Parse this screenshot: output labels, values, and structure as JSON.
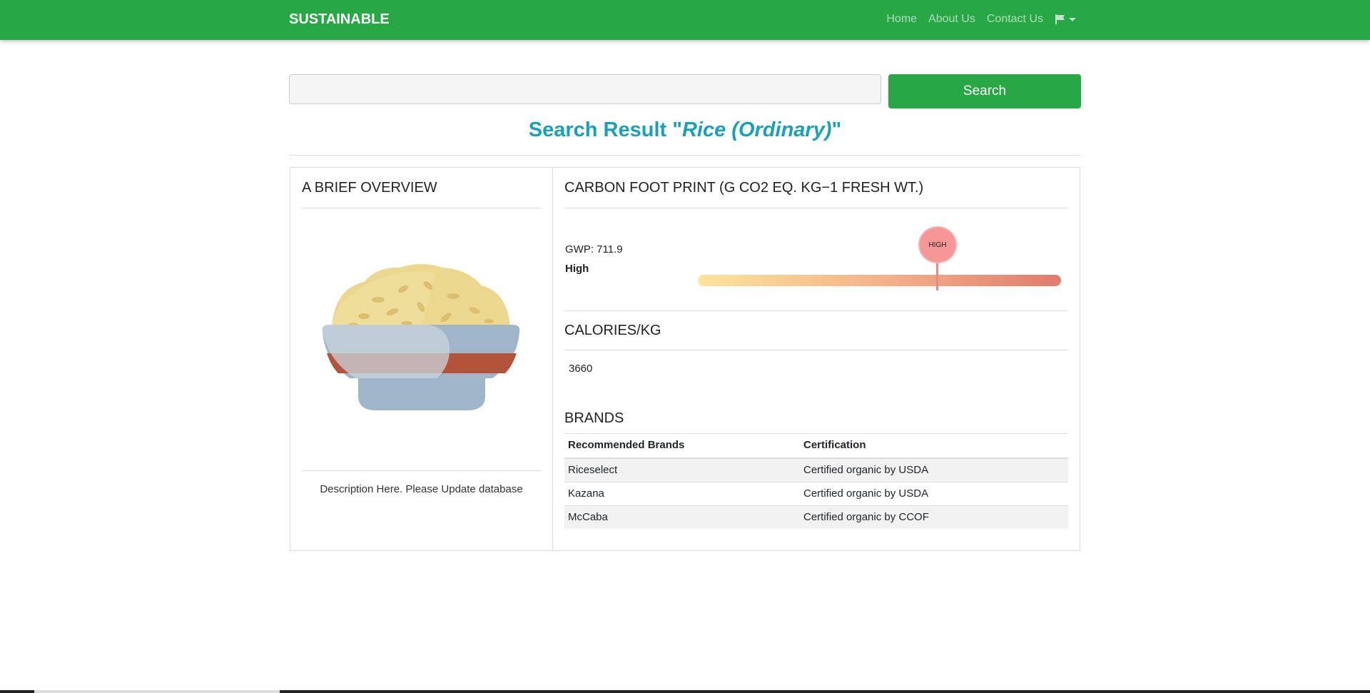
{
  "navbar": {
    "brand": "SUSTAINABLE",
    "links": [
      "Home",
      "About Us",
      "Contact Us"
    ],
    "language_icon": "flag-icon"
  },
  "search": {
    "value": "",
    "button_label": "Search"
  },
  "result": {
    "prefix": "Search Result \"",
    "query": "Rice (Ordinary)",
    "suffix": "\""
  },
  "overview": {
    "heading": "A BRIEF OVERVIEW",
    "image_icon": "rice-bowl-icon",
    "description": "Description Here. Please Update database"
  },
  "carbon": {
    "heading": "CARBON FOOT PRINT (G CO2 EQ. KG−1 FRESH WT.)",
    "gwp_text": "GWP: 711.9",
    "level_text": "High",
    "gauge_label": "HIGH",
    "gauge_level_fraction": 0.66
  },
  "calories": {
    "heading": "CALORIES/KG",
    "value": "3660"
  },
  "brands": {
    "heading": "BRANDS",
    "columns": [
      "Recommended Brands",
      "Certification"
    ],
    "rows": [
      [
        "Riceselect",
        "Certified organic by USDA"
      ],
      [
        "Kazana",
        "Certified organic by USDA"
      ],
      [
        "McCaba",
        "Certified organic by CCOF"
      ]
    ]
  },
  "colors": {
    "primary": "#28a745",
    "title": "#17a2b8",
    "gauge_start": "#fde49c",
    "gauge_end": "#e07c6c",
    "pin": "#f69797"
  }
}
